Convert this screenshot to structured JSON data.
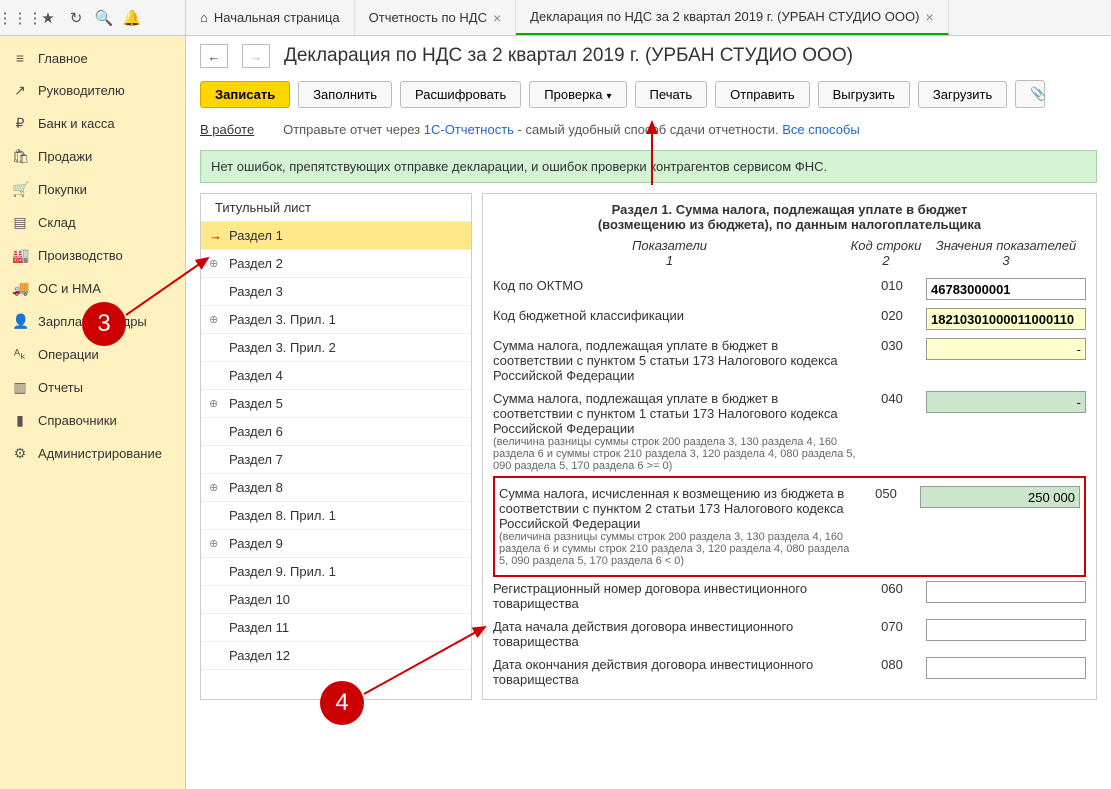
{
  "toolbar": {
    "icons": [
      "apps",
      "star",
      "history",
      "search",
      "bell"
    ]
  },
  "tabs": [
    {
      "icon": "⌂",
      "label": "Начальная страница",
      "close": false
    },
    {
      "label": "Отчетность по НДС",
      "close": true
    },
    {
      "label": "Декларация по НДС за 2 квартал 2019 г. (УРБАН СТУДИО ООО)",
      "close": true,
      "active": true
    }
  ],
  "sidebar": [
    {
      "icon": "≡",
      "label": "Главное"
    },
    {
      "icon": "↗",
      "label": "Руководителю"
    },
    {
      "icon": "₽",
      "label": "Банк и касса"
    },
    {
      "icon": "🛍",
      "label": "Продажи"
    },
    {
      "icon": "🛒",
      "label": "Покупки"
    },
    {
      "icon": "▤",
      "label": "Склад"
    },
    {
      "icon": "🏭",
      "label": "Производство"
    },
    {
      "icon": "🚚",
      "label": "ОС и НМА"
    },
    {
      "icon": "👤",
      "label": "Зарплата и кадры"
    },
    {
      "icon": "ᴬₖ",
      "label": "Операции"
    },
    {
      "icon": "▥",
      "label": "Отчеты"
    },
    {
      "icon": "▮",
      "label": "Справочники"
    },
    {
      "icon": "⚙",
      "label": "Администрирование"
    }
  ],
  "page": {
    "title": "Декларация по НДС за 2 квартал 2019 г. (УРБАН СТУДИО ООО)",
    "buttons": {
      "write": "Записать",
      "fill": "Заполнить",
      "decode": "Расшифровать",
      "check": "Проверка",
      "print": "Печать",
      "send": "Отправить",
      "export": "Выгрузить",
      "import": "Загрузить"
    },
    "status_label": "В работе",
    "status_text1": "Отправьте отчет через ",
    "status_link": "1С-Отчетность",
    "status_text2": " - самый удобный способ сдачи отчетности. ",
    "status_link2": "Все способы",
    "banner": "Нет ошибок, препятствующих отправке декларации, и ошибок проверки контрагентов сервисом ФНС."
  },
  "sections": {
    "head": "Титульный лист",
    "items": [
      {
        "label": "Раздел 1",
        "selected": true,
        "arrow": true
      },
      {
        "label": "Раздел 2",
        "exp": true
      },
      {
        "label": "Раздел 3"
      },
      {
        "label": "Раздел 3. Прил. 1",
        "exp": true
      },
      {
        "label": "Раздел 3. Прил. 2"
      },
      {
        "label": "Раздел 4"
      },
      {
        "label": "Раздел 5",
        "exp": true
      },
      {
        "label": "Раздел 6"
      },
      {
        "label": "Раздел 7"
      },
      {
        "label": "Раздел 8",
        "exp": true
      },
      {
        "label": "Раздел 8. Прил. 1"
      },
      {
        "label": "Раздел 9",
        "exp": true
      },
      {
        "label": "Раздел 9. Прил. 1"
      },
      {
        "label": "Раздел 10"
      },
      {
        "label": "Раздел 11"
      },
      {
        "label": "Раздел 12"
      }
    ]
  },
  "detail": {
    "title1": "Раздел 1. Сумма налога, подлежащая уплате в бюджет",
    "title2": "(возмещению из бюджета), по данным налогоплательщика",
    "cols": {
      "c1": "Показатели",
      "n1": "1",
      "c2": "Код строки",
      "n2": "2",
      "c3": "Значения показателей",
      "n3": "3"
    },
    "rows": [
      {
        "label": "Код по ОКТМО",
        "code": "010",
        "value": "46783000001",
        "cls": "bold"
      },
      {
        "label": "Код бюджетной классификации",
        "code": "020",
        "value": "18210301000011000110",
        "cls": "bold yellow"
      },
      {
        "label": "Сумма налога, подлежащая уплате в бюджет в соответствии с пунктом 5 статьи 173 Налогового кодекса Российской Федерации",
        "code": "030",
        "value": "-",
        "cls": "yellow"
      },
      {
        "label": "Сумма налога, подлежащая уплате в бюджет в соответствии с пунктом 1 статьи 173 Налогового кодекса Российской Федерации",
        "note": "(величина разницы суммы строк 200 раздела 3, 130 раздела 4, 160 раздела 6 и суммы строк 210 раздела 3, 120 раздела 4, 080 раздела 5, 090 раздела 5, 170 раздела 6 >= 0)",
        "code": "040",
        "value": "-",
        "cls": "green"
      },
      {
        "label": "Сумма налога, исчисленная к возмещению из бюджета в соответствии с пунктом 2 статьи 173 Налогового кодекса Российской Федерации",
        "note": "(величина разницы суммы строк 200 раздела 3, 130 раздела 4, 160 раздела 6 и суммы строк 210 раздела 3, 120 раздела 4, 080 раздела 5, 090 раздела 5, 170 раздела 6 < 0)",
        "code": "050",
        "value": "250 000",
        "cls": "green",
        "boxed": true
      },
      {
        "label": "Регистрационный номер договора инвестиционного товарищества",
        "code": "060",
        "value": ""
      },
      {
        "label": "Дата начала действия договора инвестиционного товарищества",
        "code": "070",
        "value": ""
      },
      {
        "label": "Дата окончания действия договора инвестиционного товарищества",
        "code": "080",
        "value": ""
      }
    ]
  },
  "callouts": {
    "c3": "3",
    "c4": "4"
  }
}
